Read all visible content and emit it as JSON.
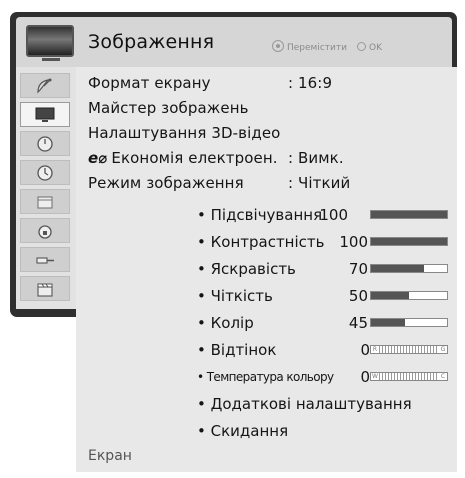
{
  "header": {
    "title": "Зображення",
    "hint_move": "Перемістити",
    "hint_ok": "OK"
  },
  "sidebar": {
    "items": [
      {
        "icon": "satellite-dish-icon"
      },
      {
        "icon": "picture-tv-icon",
        "active": true
      },
      {
        "icon": "audio-knob-icon"
      },
      {
        "icon": "clock-icon"
      },
      {
        "icon": "calendar-icon"
      },
      {
        "icon": "lock-icon"
      },
      {
        "icon": "cable-input-icon"
      },
      {
        "icon": "clapperboard-icon"
      }
    ]
  },
  "menu": {
    "items": [
      {
        "label": "Формат екрану",
        "value": ": 16:9"
      },
      {
        "label": "Майстер зображень",
        "value": ""
      },
      {
        "label": "Налаштування 3D-відео",
        "value": ""
      },
      {
        "label": "Економія електроен.",
        "value": ": Вимк.",
        "icon": "eco-icon"
      },
      {
        "label": "Режим зображення",
        "value": ": Чіткий"
      }
    ]
  },
  "settings": [
    {
      "label": "• Підсвічування",
      "value": "100",
      "level": 1.0
    },
    {
      "label": "• Контрастність",
      "value": "100",
      "level": 1.0
    },
    {
      "label": "• Яскравість",
      "value": "70",
      "level": 0.7
    },
    {
      "label": "• Чіткість",
      "value": "50",
      "level": 0.5
    },
    {
      "label": "• Колір",
      "value": "45",
      "level": 0.45
    },
    {
      "label": "• Відтінок",
      "value": "0",
      "mark_left": "R",
      "mark_right": "G"
    },
    {
      "label": "• Температура кольору",
      "value": "0",
      "mark_left": "W",
      "mark_right": "C"
    },
    {
      "label": "• Додаткові налаштування"
    },
    {
      "label": "• Скидання"
    }
  ],
  "footer": "Екран",
  "colors": {
    "bar_fill": "#555555",
    "panel": "#e8e8e8",
    "frame": "#2f2f2f"
  }
}
